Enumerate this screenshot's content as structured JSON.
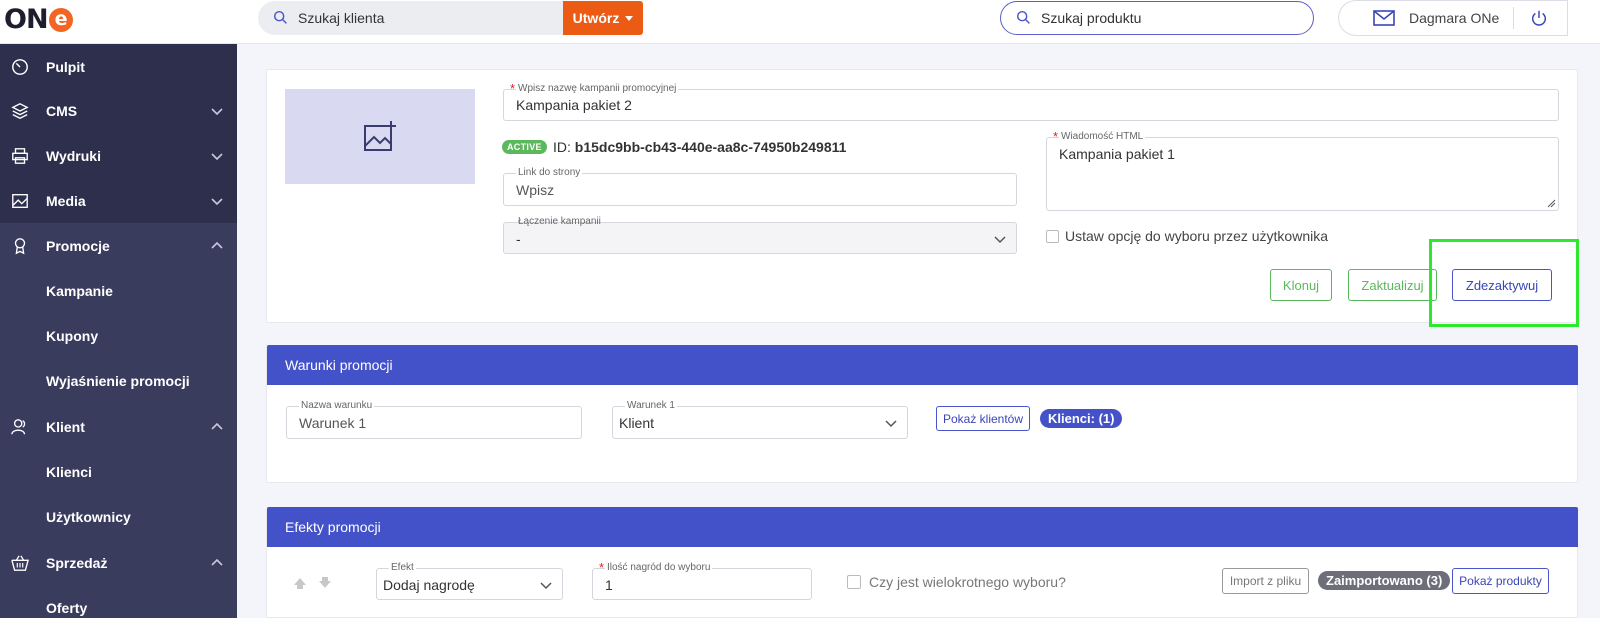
{
  "topbar": {
    "logo_text": "ON",
    "logo_e": "e",
    "search_client_placeholder": "Szukaj klienta",
    "create_button": "Utwórz",
    "search_product_placeholder": "Szukaj produktu",
    "user_name": "Dagmara ONe"
  },
  "sidebar": {
    "items": [
      {
        "label": "Pulpit",
        "icon": "dashboard-icon"
      },
      {
        "label": "CMS",
        "icon": "layers-icon"
      },
      {
        "label": "Wydruki",
        "icon": "printer-icon"
      },
      {
        "label": "Media",
        "icon": "image-icon"
      },
      {
        "label": "Promocje",
        "icon": "award-icon"
      },
      {
        "label": "Kampanie"
      },
      {
        "label": "Kupony"
      },
      {
        "label": "Wyjaśnienie promocji"
      },
      {
        "label": "Klient",
        "icon": "users-icon"
      },
      {
        "label": "Klienci"
      },
      {
        "label": "Użytkownicy"
      },
      {
        "label": "Sprzedaż",
        "icon": "basket-icon"
      },
      {
        "label": "Oferty"
      }
    ]
  },
  "campaign": {
    "name_label": "Wpisz nazwę kampanii promocyjnej",
    "name_value": "Kampania pakiet 2",
    "status_badge": "ACTIVE",
    "id_prefix": "ID:",
    "id_value": "b15dc9bb-cb43-440e-aa8c-74950b249811",
    "link_label": "Link do strony",
    "link_placeholder": "Wpisz",
    "merge_label": "Łączenie kampanii",
    "merge_value": "-",
    "html_label": "Wiadomość HTML",
    "html_value": "Kampania pakiet 1",
    "user_option_label": "Ustaw opcję do wyboru przez użytkownika",
    "clone_button": "Klonuj",
    "update_button": "Zaktualizuj",
    "deactivate_button": "Zdezaktywuj"
  },
  "conditions": {
    "title": "Warunki promocji",
    "name_label": "Nazwa warunku",
    "name_value": "Warunek 1",
    "cond_label": "Warunek 1",
    "cond_value": "Klient",
    "show_clients_button": "Pokaż klientów",
    "clients_pill": "Klienci: (1)"
  },
  "effects": {
    "title": "Efekty promocji",
    "effect_label": "Efekt",
    "effect_value": "Dodaj nagrodę",
    "rewards_label": "Ilość nagród do wyboru",
    "rewards_value": "1",
    "multi_label": "Czy jest wielokrotnego wyboru?",
    "import_button": "Import z pliku",
    "imported_pill": "Zaimportowano (3)",
    "show_products_button": "Pokaż produkty"
  },
  "colors": {
    "sidebar_bg": "#2d2f4c",
    "accent_orange": "#ec5b13",
    "section_blue": "#4352c8",
    "success_green": "#5cb85c",
    "highlight_green": "#2de82d"
  }
}
